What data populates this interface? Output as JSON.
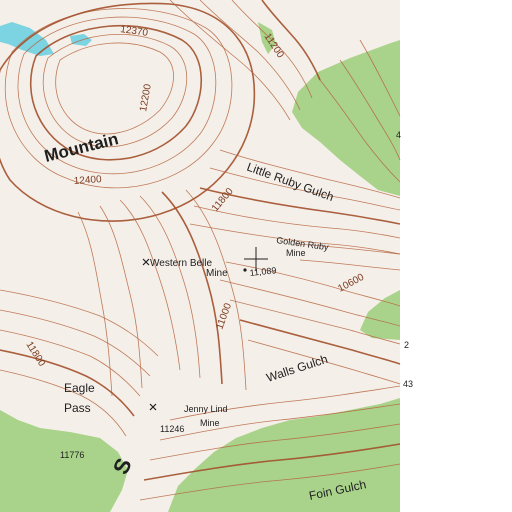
{
  "map": {
    "colors": {
      "paper": "#f5efe9",
      "contour": "#b5653e",
      "index_contour": "#a24f2a",
      "vegetation": "#a9d38a",
      "water": "#6fcfe0",
      "outside": "#ffffff",
      "label": "#1f1f1f",
      "elevation_label": "#7a3b20"
    },
    "labels": {
      "mountain": "Mountain",
      "little_ruby_gulch": "Little Ruby Gulch",
      "golden_ruby_mine_1": "Golden Ruby",
      "golden_ruby_mine_2": "Mine",
      "western_belle": "Western Belle",
      "mine": "Mine",
      "elev_11089": "11,089",
      "walls_gulch": "Walls Gulch",
      "eagle": "Eagle",
      "pass": "Pass",
      "jenny_lind": "Jenny Lind",
      "jenny_lind_mine": "Mine",
      "elev_11246": "11246",
      "elev_11776": "11776",
      "foin_gulch": "Foin Gulch",
      "partial_s": "S",
      "margin_4": "4",
      "margin_43": "43",
      "margin_2": "2"
    },
    "elevations": {
      "e12370": "12370",
      "e12200": "12200",
      "e12400": "12400",
      "e11800_north": "11800",
      "e11800_west": "11800",
      "e11200": "11200",
      "e11000": "11000",
      "e10600": "10600"
    },
    "icons": [
      "mine-symbol-icon",
      "benchmark-cross-icon"
    ]
  }
}
